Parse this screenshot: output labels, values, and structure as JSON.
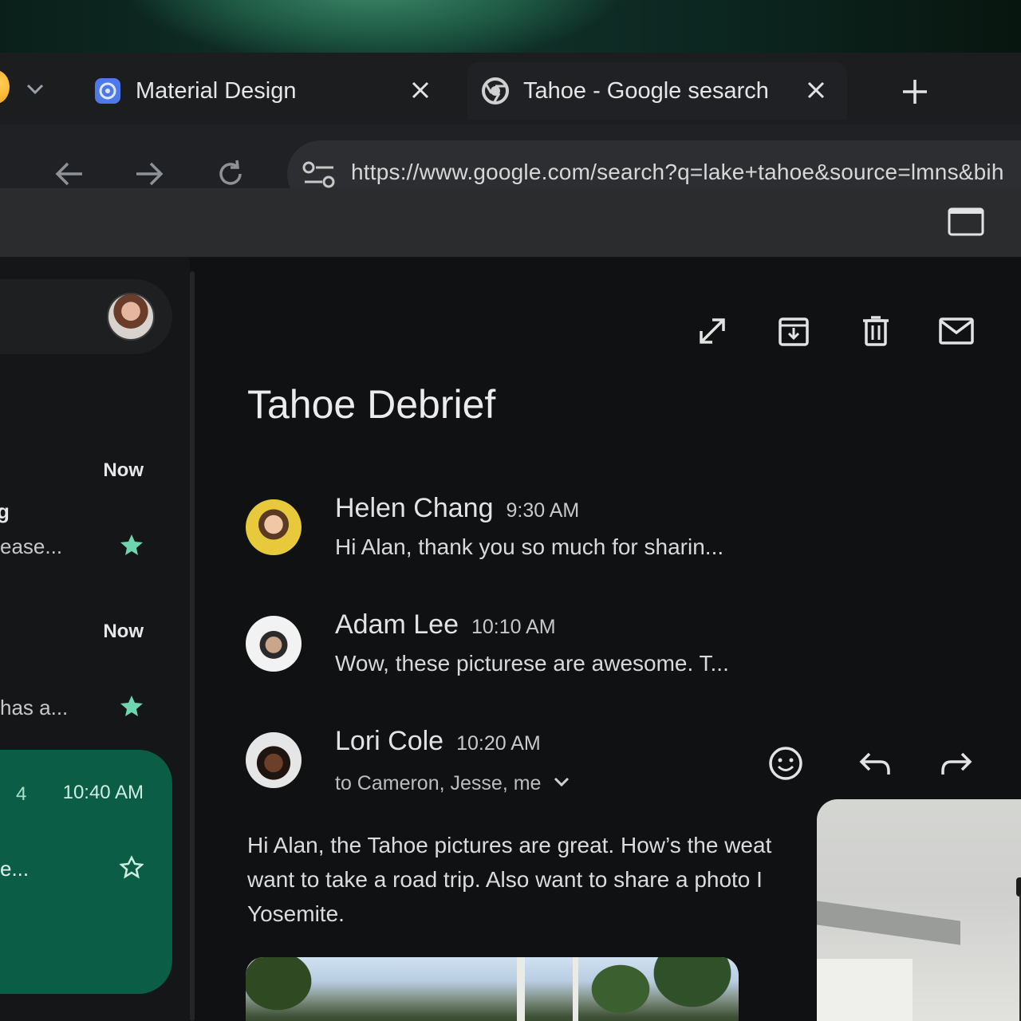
{
  "browser": {
    "tabs": [
      {
        "title": "Material Design",
        "favicon": "material-design-logo",
        "active": false
      },
      {
        "title": "Tahoe - Google sesarch",
        "favicon": "chrome-logo",
        "active": true
      }
    ],
    "url": "https://www.google.com/search?q=lake+tahoe&source=lmns&bih"
  },
  "mail": {
    "sidebar": {
      "items": [
        {
          "time": "Now",
          "name": "g",
          "snippet": "ease...",
          "starred": true
        },
        {
          "time": "Now",
          "name": "",
          "snippet": "has a...",
          "starred": true
        },
        {
          "count": "4",
          "time": "10:40 AM",
          "snippet": "e...",
          "starred": false
        }
      ]
    },
    "thread": {
      "subject": "Tahoe Debrief",
      "messages": [
        {
          "sender": "Helen Chang",
          "time": "9:30 AM",
          "snippet": "Hi Alan, thank you so much for sharin..."
        },
        {
          "sender": "Adam Lee",
          "time": "10:10 AM",
          "snippet": "Wow, these picturese are awesome. T..."
        },
        {
          "sender": "Lori Cole",
          "time": "10:20 AM",
          "recipients": "to Cameron, Jesse, me"
        }
      ],
      "body": "Hi Alan, the Tahoe pictures are great. How’s the weat want to take a road trip. Also want to share a photo I Yosemite."
    }
  },
  "colors": {
    "selected_item": "#0b5e45",
    "star": "#6dd6b0",
    "background": "#0f1112"
  }
}
